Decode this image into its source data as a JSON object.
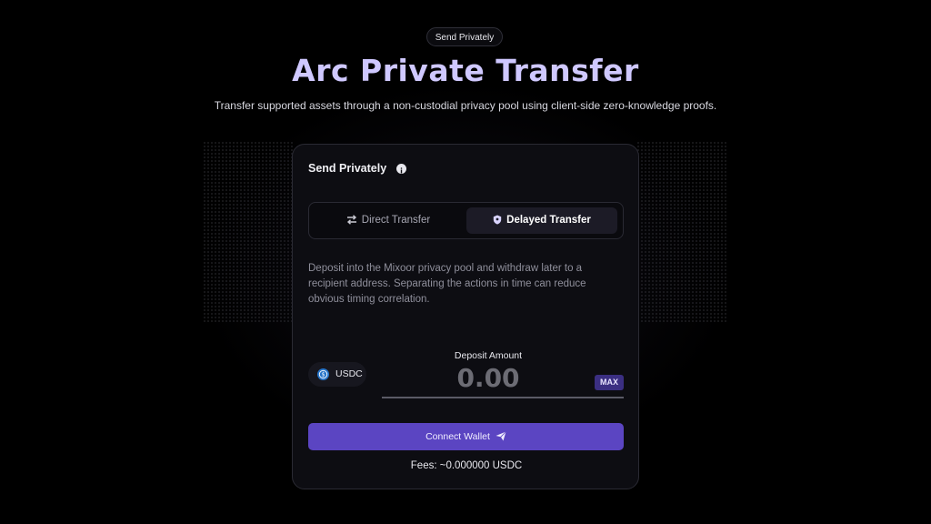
{
  "header": {
    "pill_label": "Send Privately",
    "title": "Arc Private Transfer",
    "subtitle": "Transfer supported assets through a non-custodial privacy pool using client-side zero-knowledge proofs."
  },
  "card": {
    "title": "Send Privately",
    "info_icon": "info-icon",
    "tabs": [
      {
        "label": "Direct  Transfer",
        "icon": "swap-arrows-icon",
        "active": false
      },
      {
        "label": "Delayed  Transfer",
        "icon": "shield-icon",
        "active": true
      }
    ],
    "description": "Deposit into the Mixoor privacy pool and withdraw later to a recipient address. Separating the actions in time can reduce obvious timing correlation.",
    "token": {
      "label": "USDC",
      "icon": "usdc-coin-icon"
    },
    "amount": {
      "label": "Deposit Amount",
      "placeholder": "0.00",
      "max_label": "MAX"
    },
    "connect_button": {
      "label": "Connect Wallet",
      "icon": "send-plane-icon"
    },
    "fees": "Fees: ~0.000000 USDC"
  },
  "colors": {
    "background": "#000000",
    "accent": "#5b45c2",
    "title": "#cfc8ff",
    "max_button": "#3b2f82"
  }
}
